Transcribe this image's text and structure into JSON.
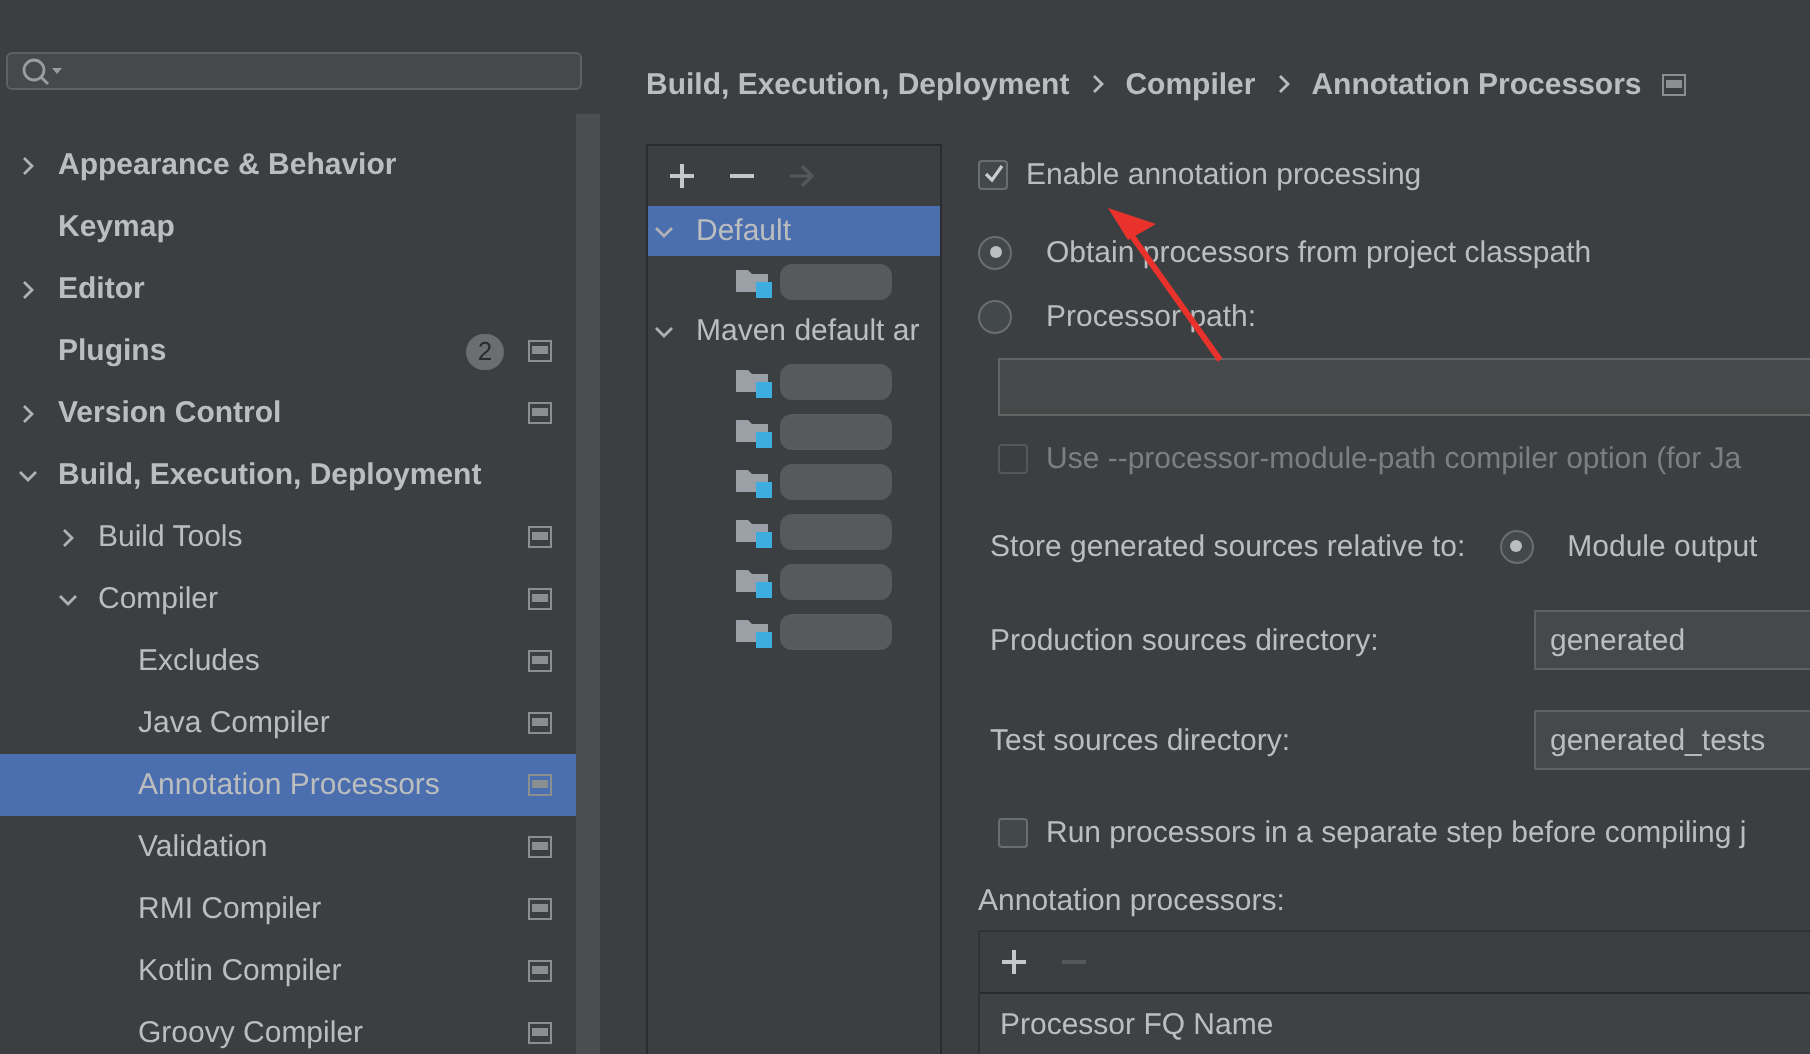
{
  "sidebar": {
    "items": [
      {
        "label": "Appearance & Behavior",
        "bold": true,
        "expanded": false,
        "has_children": true,
        "selected": false,
        "scope_icon": false
      },
      {
        "label": "Keymap",
        "bold": true,
        "has_children": false,
        "selected": false,
        "scope_icon": false
      },
      {
        "label": "Editor",
        "bold": true,
        "expanded": false,
        "has_children": true,
        "selected": false,
        "scope_icon": false
      },
      {
        "label": "Plugins",
        "bold": true,
        "has_children": false,
        "selected": false,
        "badge": "2",
        "scope_icon": true
      },
      {
        "label": "Version Control",
        "bold": true,
        "expanded": false,
        "has_children": true,
        "selected": false,
        "scope_icon": true
      },
      {
        "label": "Build, Execution, Deployment",
        "bold": true,
        "expanded": true,
        "has_children": true,
        "selected": false,
        "scope_icon": false,
        "children": [
          {
            "label": "Build Tools",
            "bold": false,
            "expanded": false,
            "has_children": true,
            "selected": false,
            "scope_icon": true
          },
          {
            "label": "Compiler",
            "bold": false,
            "expanded": true,
            "has_children": true,
            "selected": false,
            "scope_icon": true,
            "children": [
              {
                "label": "Excludes",
                "bold": false,
                "has_children": false,
                "selected": false,
                "scope_icon": true
              },
              {
                "label": "Java Compiler",
                "bold": false,
                "has_children": false,
                "selected": false,
                "scope_icon": true
              },
              {
                "label": "Annotation Processors",
                "bold": false,
                "has_children": false,
                "selected": true,
                "scope_icon": true
              },
              {
                "label": "Validation",
                "bold": false,
                "has_children": false,
                "selected": false,
                "scope_icon": true
              },
              {
                "label": "RMI Compiler",
                "bold": false,
                "has_children": false,
                "selected": false,
                "scope_icon": true
              },
              {
                "label": "Kotlin Compiler",
                "bold": false,
                "has_children": false,
                "selected": false,
                "scope_icon": true
              },
              {
                "label": "Groovy Compiler",
                "bold": false,
                "has_children": false,
                "selected": false,
                "scope_icon": true
              }
            ]
          }
        ]
      }
    ]
  },
  "breadcrumb": [
    "Build, Execution, Deployment",
    "Compiler",
    "Annotation Processors"
  ],
  "profiles": {
    "toolbar": [
      {
        "kind": "add",
        "disabled": false
      },
      {
        "kind": "remove",
        "disabled": false
      },
      {
        "kind": "move",
        "disabled": true
      }
    ],
    "items": [
      {
        "label": "Default",
        "expanded": true,
        "selected": true,
        "children": [
          {
            "kind": "blurred_module"
          }
        ]
      },
      {
        "label": "Maven default ar",
        "expanded": true,
        "selected": false,
        "children": [
          {
            "kind": "blurred_module"
          },
          {
            "kind": "blurred_module"
          },
          {
            "kind": "blurred_module"
          },
          {
            "kind": "blurred_module"
          },
          {
            "kind": "blurred_module"
          },
          {
            "kind": "blurred_module"
          }
        ]
      }
    ]
  },
  "settings": {
    "enable": {
      "label": "Enable annotation processing",
      "checked": true
    },
    "source_options": [
      {
        "label": "Obtain processors from project classpath",
        "selected": true
      },
      {
        "label": "Processor path:",
        "selected": false
      }
    ],
    "processor_path": {
      "shown": true
    },
    "module_path_option": {
      "label": "Use --processor-module-path compiler option (for Ja",
      "checked": false,
      "disabled": true
    },
    "store": {
      "label": "Store generated sources relative to:",
      "options": [
        {
          "label": "Module output",
          "selected": true
        }
      ]
    },
    "directories": [
      {
        "label": "Production sources directory:",
        "value": "generated"
      },
      {
        "label": "Test sources directory:",
        "value": "generated_tests"
      }
    ],
    "separate_step": {
      "label": "Run processors in a separate step before compiling j",
      "checked": false,
      "disabled": false
    },
    "processors": {
      "label": "Annotation processors:",
      "toolbar": [
        {
          "kind": "add",
          "disabled": false
        },
        {
          "kind": "remove",
          "disabled": true
        }
      ],
      "columns": [
        "Processor FQ Name"
      ]
    }
  }
}
